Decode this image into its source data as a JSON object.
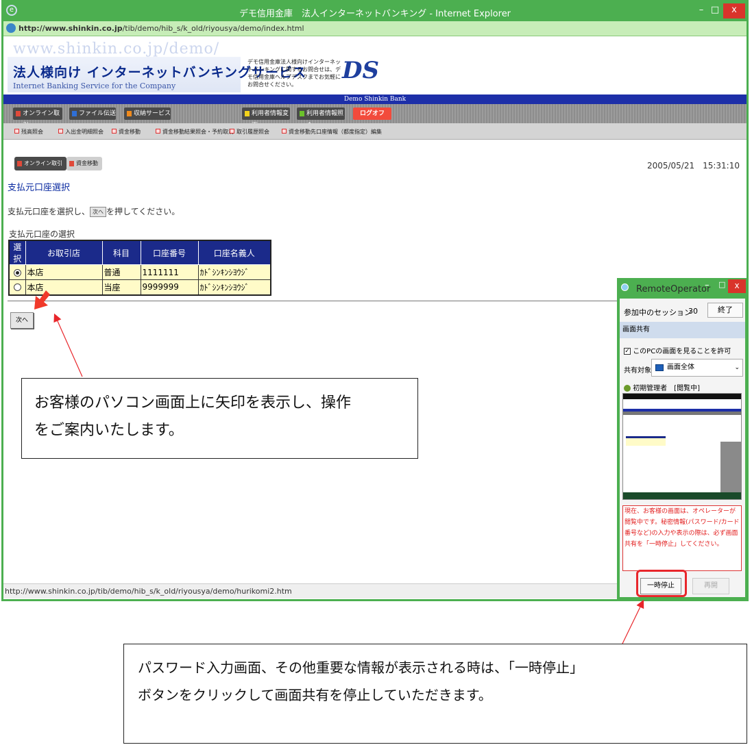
{
  "browser": {
    "title": "デモ信用金庫　法人インターネットバンキング - Internet Explorer",
    "url_host": "http://www.shinkin.co.jp",
    "url_path": "/tib/demo/hib_s/k_old/riyousya/demo/index.html",
    "min_glyph": "–",
    "max_glyph": "□",
    "close_glyph": "x",
    "ie_glyph": "e",
    "status_url": "http://www.shinkin.co.jp/tib/demo/hib_s/k_old/riyousya/demo/hurikomi2.htm"
  },
  "bank": {
    "watermark": "www.shinkin.co.jp/demo/",
    "service_title": "法人様向け インターネットバンキングサービス",
    "service_subtitle": "Internet Banking Service for the Company",
    "notice": "デモ信用金庫法人様向けインターネットバンキングに関するお問合せは、デモ信用金庫ヘルプデスクまでお気軽にお問合せください。",
    "logo": "DS",
    "bank_name": "Demo Shinkin Bank"
  },
  "nav": {
    "items": [
      {
        "label": "オンライン取引",
        "color": "#e04a3a"
      },
      {
        "label": "ファイル伝送",
        "color": "#2f6fd6"
      },
      {
        "label": "収納サービス",
        "color": "#f08a1c"
      },
      {
        "label": "利用者情報変更",
        "color": "#f3d21b"
      },
      {
        "label": "利用者情報照会",
        "color": "#6bc12b"
      }
    ],
    "logoff": "ログオフ"
  },
  "subnav": {
    "items": [
      "残高照会",
      "入出金明細照会",
      "資金移動",
      "資金移動結果照会・予約取消",
      "取引履歴照会",
      "資金移動先口座情報（都度指定）編集"
    ]
  },
  "crumbs": {
    "online": "オンライン取引",
    "move": "資金移動"
  },
  "datetime": "2005/05/21　15:31:10",
  "page": {
    "title": "支払元口座選択",
    "instruction_before": "支払元口座を選択し、",
    "instruction_after": "を押してください。",
    "inline_next": "次へ",
    "selection_label": "支払元口座の選択",
    "next_button": "次へ"
  },
  "table": {
    "headers": [
      "選択",
      "お取引店",
      "科目",
      "口座番号",
      "口座名義人"
    ],
    "rows": [
      {
        "selected": true,
        "branch": "本店",
        "subject": "普通",
        "number": "1111111",
        "holder": "ｶﾄﾞｼﾝｷﾝｼﾖｳｼﾞ"
      },
      {
        "selected": false,
        "branch": "本店",
        "subject": "当座",
        "number": "9999999",
        "holder": "ｶﾄﾞｼﾝｷﾝｼﾖｳｼﾞ"
      }
    ]
  },
  "remote": {
    "title": "RemoteOperator",
    "min_glyph": "–",
    "max_glyph": "□",
    "close_glyph": "x",
    "session_label": "参加中のセッション",
    "session_count": "30",
    "end_button": "終了",
    "share_header": "画面共有",
    "check_mark": "✓",
    "allow_label": "このPCの画面を見ることを許可",
    "target_label": "共有対象",
    "target_value": "画面全体",
    "select_arrow": "⌄",
    "admin_label": "初期管理者　[閲覧中]",
    "warning": "現在、お客様の画面は、オペレーターが閲覧中です。秘密情報(パスワード/カード番号など)の入力や表示の際は、必ず画面共有を「一時停止」してください。",
    "pause_button": "一時停止",
    "resume_button": "再開"
  },
  "annotations": {
    "callout1_line1": "お客様のパソコン画面上に矢印を表示し、操作",
    "callout1_line2": "をご案内いたします。",
    "callout2_line1": "パスワード入力画面、その他重要な情報が表示される時は、「一時停止」",
    "callout2_line2": "ボタンをクリックして画面共有を停止していただきます。"
  },
  "colors": {
    "window_border": "#4caf50",
    "pointer_arrow": "#f03a2a",
    "annotation_line": "#e8262b"
  }
}
